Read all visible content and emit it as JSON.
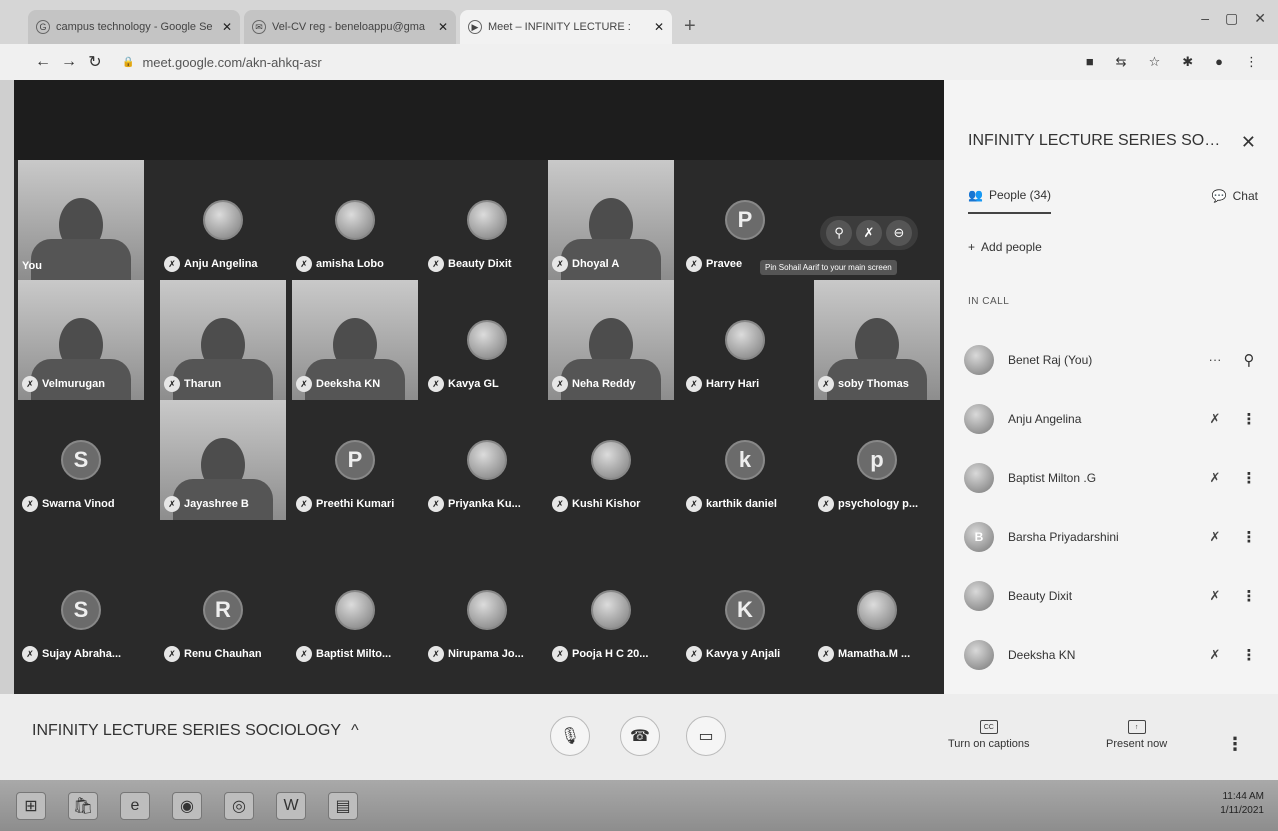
{
  "browser": {
    "tabs": [
      {
        "title": "campus technology - Google Se",
        "favicon": "google-icon",
        "active": false
      },
      {
        "title": "Vel-CV reg - beneloappu@gma",
        "favicon": "mail-icon",
        "active": false
      },
      {
        "title": "Meet – INFINITY LECTURE :",
        "favicon": "meet-icon",
        "active": true
      }
    ],
    "url": "meet.google.com/akn-ahkq-asr"
  },
  "stage": {
    "tiles": [
      {
        "name": "You",
        "kind": "video"
      },
      {
        "name": "Anju Angelina",
        "kind": "avatar",
        "letter": ""
      },
      {
        "name": "amisha Lobo",
        "kind": "avatar",
        "letter": ""
      },
      {
        "name": "Beauty Dixit",
        "kind": "avatar",
        "letter": ""
      },
      {
        "name": "Dhoyal A",
        "kind": "video"
      },
      {
        "name": "Pravee",
        "kind": "avatar",
        "letter": "P"
      },
      {
        "name": "Velmurugan",
        "kind": "video"
      },
      {
        "name": "Tharun",
        "kind": "video"
      },
      {
        "name": "Deeksha KN",
        "kind": "video"
      },
      {
        "name": "Kavya GL",
        "kind": "avatar",
        "letter": ""
      },
      {
        "name": "Neha Reddy",
        "kind": "video"
      },
      {
        "name": "Harry Hari",
        "kind": "avatar",
        "letter": ""
      },
      {
        "name": "soby Thomas",
        "kind": "video"
      },
      {
        "name": "Swarna Vinod",
        "kind": "avatar",
        "letter": "S"
      },
      {
        "name": "Jayashree B",
        "kind": "video"
      },
      {
        "name": "Preethi Kumari",
        "kind": "avatar",
        "letter": "P"
      },
      {
        "name": "Priyanka Ku...",
        "kind": "avatar",
        "letter": ""
      },
      {
        "name": "Kushi Kishor",
        "kind": "avatar",
        "letter": ""
      },
      {
        "name": "karthik daniel",
        "kind": "avatar",
        "letter": "k"
      },
      {
        "name": "psychology p...",
        "kind": "avatar",
        "letter": "p"
      },
      {
        "name": "Sujay Abraha...",
        "kind": "avatar",
        "letter": "S"
      },
      {
        "name": "Renu Chauhan",
        "kind": "avatar",
        "letter": "R"
      },
      {
        "name": "Baptist Milto...",
        "kind": "avatar",
        "letter": ""
      },
      {
        "name": "Nirupama Jo...",
        "kind": "avatar",
        "letter": ""
      },
      {
        "name": "Pooja H C 20...",
        "kind": "avatar",
        "letter": ""
      },
      {
        "name": "Kavya y Anjali",
        "kind": "avatar",
        "letter": "K"
      },
      {
        "name": "Mamatha.M ...",
        "kind": "avatar",
        "letter": ""
      }
    ],
    "tooltip": "Pin Sohail Aarif to your main screen"
  },
  "meeting": {
    "title": "INFINITY LECTURE SERIES SOCIOLOGY",
    "captions_label": "Turn on captions",
    "present_label": "Present now"
  },
  "panel": {
    "title": "INFINITY LECTURE SERIES SOCIO...",
    "people_tab": "People (34)",
    "chat_tab": "Chat",
    "add_people": "Add people",
    "in_call": "IN CALL",
    "people": [
      {
        "name": "Benet Raj (You)",
        "initial": ""
      },
      {
        "name": "Anju Angelina",
        "initial": ""
      },
      {
        "name": "Baptist Milton .G",
        "initial": ""
      },
      {
        "name": "Barsha Priyadarshini",
        "initial": "B"
      },
      {
        "name": "Beauty Dixit",
        "initial": ""
      },
      {
        "name": "Deeksha KN",
        "initial": ""
      }
    ]
  },
  "taskbar": {
    "time": "11:44 AM",
    "date": "1/11/2021"
  }
}
